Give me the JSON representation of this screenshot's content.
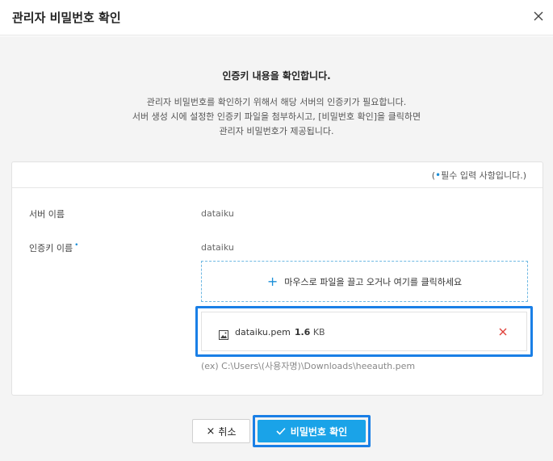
{
  "dialog": {
    "title": "관리자 비밀번호 확인"
  },
  "intro": {
    "headline": "인증키 내용을 확인합니다.",
    "description": [
      "관리자 비밀번호를 확인하기 위해서 해당 서버의 인증키가 필요합니다.",
      "서버 생성 시에 설정한 인증키 파일을 첨부하시고, [비밀번호 확인]을 클릭하면",
      "관리자 비밀번호가 제공됩니다."
    ]
  },
  "form": {
    "required_note_open": "(",
    "required_note_dot": "•",
    "required_note_text": "필수 입력 사항입니다.)",
    "server_name_label": "서버 이름",
    "server_name_value": "dataiku",
    "key_name_label": "인증키 이름",
    "key_name_required_mark": "•",
    "key_name_value": "dataiku",
    "dropzone_text": "마우스로 파일을 끌고 오거나 여기를 클릭하세요",
    "file": {
      "name": "dataiku.pem",
      "size": "1.6",
      "unit": "KB"
    },
    "example_path": "(ex) C:\\Users\\(사용자명)\\Downloads\\heeauth.pem"
  },
  "buttons": {
    "cancel_label": "취소",
    "cancel_icon": "×",
    "confirm_label": "비밀번호 확인"
  },
  "colors": {
    "accent": "#1aa3e8",
    "highlight": "#1a7fe6",
    "remove": "#e0413a"
  }
}
